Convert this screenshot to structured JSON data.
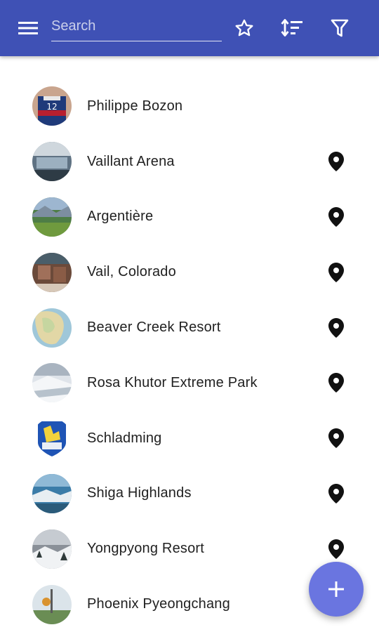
{
  "toolbar": {
    "menu_icon": "menu-icon",
    "search_placeholder": "Search",
    "search_value": "",
    "star_icon": "star-outline-icon",
    "sort_icon": "sort-icon",
    "filter_icon": "filter-icon",
    "background": "#3f51b5"
  },
  "list": {
    "items": [
      {
        "label": "Philippe Bozon",
        "has_location": false
      },
      {
        "label": "Vaillant Arena",
        "has_location": true
      },
      {
        "label": "Argentière",
        "has_location": true
      },
      {
        "label": "Vail, Colorado",
        "has_location": true
      },
      {
        "label": "Beaver Creek Resort",
        "has_location": true
      },
      {
        "label": "Rosa Khutor Extreme Park",
        "has_location": true
      },
      {
        "label": "Schladming",
        "has_location": true
      },
      {
        "label": "Shiga Highlands",
        "has_location": true
      },
      {
        "label": "Yongpyong Resort",
        "has_location": true
      },
      {
        "label": "Phoenix Pyeongchang",
        "has_location": false
      }
    ]
  },
  "fab": {
    "icon": "plus-icon",
    "color": "#6a75e0"
  }
}
